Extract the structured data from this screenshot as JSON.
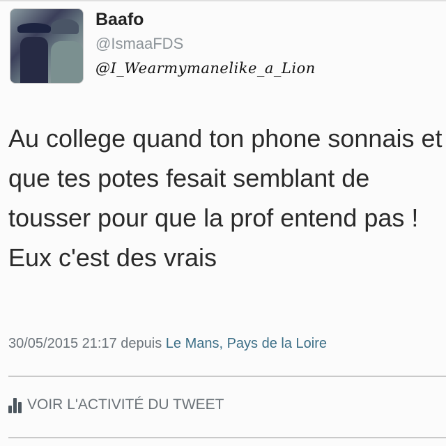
{
  "tweet": {
    "display_name": "Baafo",
    "handle": "@IsmaaFDS",
    "watermark": "@I_Wearmymanelike_a_Lion",
    "text": "Au college quand ton phone sonnais et que tes potes fesait semblant de tousser pour que la prof entend pas ! Eux c'est des vrais",
    "timestamp": "30/05/2015 21:17",
    "via": "depuis",
    "location": "Le Mans, Pays de la Loire",
    "activity_label": "VOIR L'ACTIVITÉ DU TWEET",
    "activity_icon": "bar-chart-icon"
  },
  "colors": {
    "location_link": "#3b6e86",
    "handle": "#8d9499"
  }
}
